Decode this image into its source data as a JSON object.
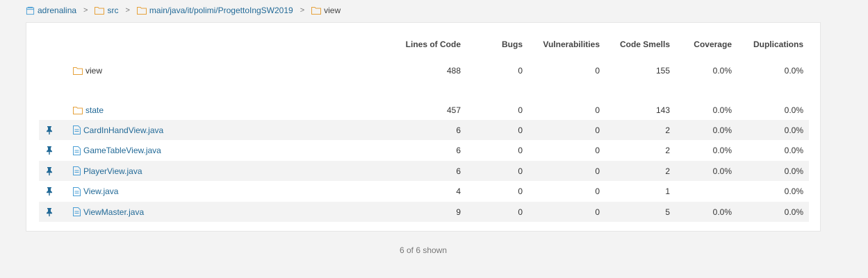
{
  "breadcrumb": [
    {
      "label": "adrenalina",
      "icon": "project-icon"
    },
    {
      "label": "src",
      "icon": "folder-icon"
    },
    {
      "label": "main/java/it/polimi/ProgettoIngSW2019",
      "icon": "folder-icon"
    },
    {
      "label": "view",
      "icon": "folder-icon"
    }
  ],
  "breadcrumb_separator": ">",
  "columns": {
    "loc": "Lines of Code",
    "bugs": "Bugs",
    "vulnerabilities": "Vulnerabilities",
    "code_smells": "Code Smells",
    "coverage": "Coverage",
    "duplications": "Duplications"
  },
  "base_row": {
    "name": "view",
    "loc": "488",
    "bugs": "0",
    "vulnerabilities": "0",
    "code_smells": "155",
    "coverage": "0.0%",
    "duplications": "0.0%"
  },
  "rows": [
    {
      "name": "state",
      "type": "folder",
      "loc": "457",
      "bugs": "0",
      "vulnerabilities": "0",
      "code_smells": "143",
      "coverage": "0.0%",
      "duplications": "0.0%"
    },
    {
      "name": "CardInHandView.java",
      "type": "file",
      "loc": "6",
      "bugs": "0",
      "vulnerabilities": "0",
      "code_smells": "2",
      "coverage": "0.0%",
      "duplications": "0.0%"
    },
    {
      "name": "GameTableView.java",
      "type": "file",
      "loc": "6",
      "bugs": "0",
      "vulnerabilities": "0",
      "code_smells": "2",
      "coverage": "0.0%",
      "duplications": "0.0%"
    },
    {
      "name": "PlayerView.java",
      "type": "file",
      "loc": "6",
      "bugs": "0",
      "vulnerabilities": "0",
      "code_smells": "2",
      "coverage": "0.0%",
      "duplications": "0.0%"
    },
    {
      "name": "View.java",
      "type": "file",
      "loc": "4",
      "bugs": "0",
      "vulnerabilities": "0",
      "code_smells": "1",
      "coverage": "",
      "duplications": "0.0%"
    },
    {
      "name": "ViewMaster.java",
      "type": "file",
      "loc": "9",
      "bugs": "0",
      "vulnerabilities": "0",
      "code_smells": "5",
      "coverage": "0.0%",
      "duplications": "0.0%"
    }
  ],
  "footer": "6 of 6 shown",
  "colors": {
    "link": "#236a97",
    "folder": "#e6a23c",
    "file": "#4b9fd5",
    "pin": "#236a97"
  }
}
